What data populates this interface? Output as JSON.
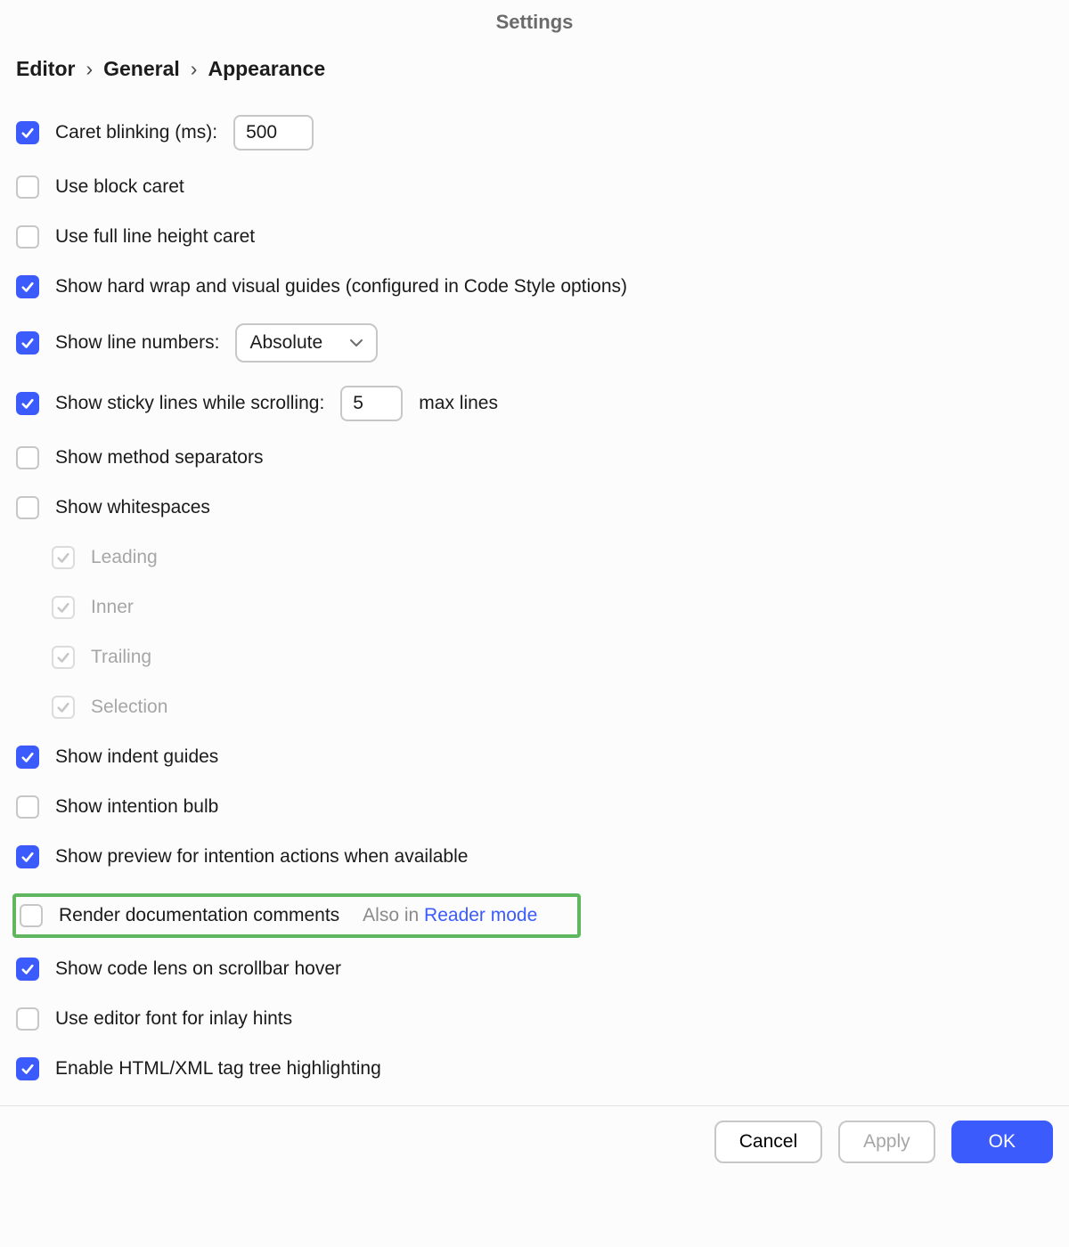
{
  "title": "Settings",
  "breadcrumb": {
    "l0": "Editor",
    "l1": "General",
    "l2": "Appearance",
    "sep": "›"
  },
  "options": {
    "caret_blinking": {
      "label": "Caret blinking (ms):",
      "value": "500",
      "checked": true
    },
    "block_caret": {
      "label": "Use block caret",
      "checked": false
    },
    "full_line_caret": {
      "label": "Use full line height caret",
      "checked": false
    },
    "hard_wrap": {
      "label": "Show hard wrap and visual guides (configured in Code Style options)",
      "checked": true
    },
    "line_numbers": {
      "label": "Show line numbers:",
      "checked": true,
      "select_value": "Absolute"
    },
    "sticky_lines": {
      "label": "Show sticky lines while scrolling:",
      "checked": true,
      "value": "5",
      "suffix": "max lines"
    },
    "method_separators": {
      "label": "Show method separators",
      "checked": false
    },
    "whitespaces": {
      "label": "Show whitespaces",
      "checked": false
    },
    "ws_leading": {
      "label": "Leading"
    },
    "ws_inner": {
      "label": "Inner"
    },
    "ws_trailing": {
      "label": "Trailing"
    },
    "ws_selection": {
      "label": "Selection"
    },
    "indent_guides": {
      "label": "Show indent guides",
      "checked": true
    },
    "intention_bulb": {
      "label": "Show intention bulb",
      "checked": false
    },
    "intention_preview": {
      "label": "Show preview for intention actions when available",
      "checked": true
    },
    "render_doc": {
      "label": "Render documentation comments",
      "checked": false,
      "hint_prefix": "Also in ",
      "hint_link": "Reader mode"
    },
    "code_lens": {
      "label": "Show code lens on scrollbar hover",
      "checked": true
    },
    "editor_font_inlay": {
      "label": "Use editor font for inlay hints",
      "checked": false
    },
    "html_tag_tree": {
      "label": "Enable HTML/XML tag tree highlighting",
      "checked": true
    }
  },
  "buttons": {
    "cancel": "Cancel",
    "apply": "Apply",
    "ok": "OK"
  }
}
